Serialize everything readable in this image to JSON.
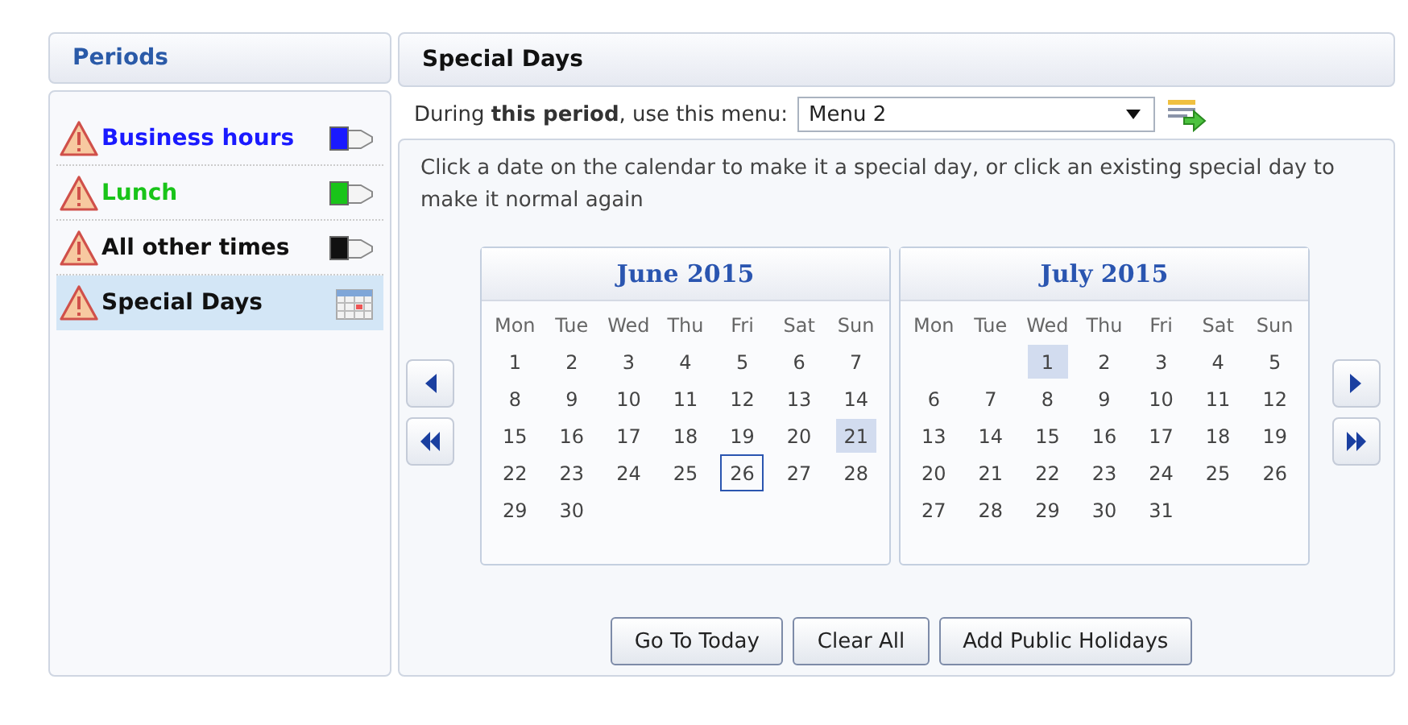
{
  "periods_panel": {
    "title": "Periods",
    "items": [
      {
        "label": "Business hours",
        "color": "#1a1aff",
        "kind": "flag",
        "warning": true,
        "selected": false
      },
      {
        "label": "Lunch",
        "color": "#19c419",
        "kind": "flag",
        "warning": true,
        "selected": false
      },
      {
        "label": "All other times",
        "color": "#111111",
        "kind": "flag",
        "warning": true,
        "selected": false
      },
      {
        "label": "Special Days",
        "color": "#111111",
        "kind": "calendar",
        "warning": true,
        "selected": true
      }
    ]
  },
  "special_days_panel": {
    "title": "Special Days",
    "menu_row": {
      "text": "During **this period**, use this menu:",
      "value": "Menu 2"
    },
    "instructions": "Click a date on the calendar to make it a special day, or click an existing special day to make it normal again",
    "calendars": [
      {
        "title": "June 2015",
        "weekdays": [
          "Mon",
          "Tue",
          "Wed",
          "Thu",
          "Fri",
          "Sat",
          "Sun"
        ],
        "weeks": [
          [
            {
              "day": "1"
            },
            {
              "day": "2"
            },
            {
              "day": "3"
            },
            {
              "day": "4"
            },
            {
              "day": "5"
            },
            {
              "day": "6"
            },
            {
              "day": "7"
            }
          ],
          [
            {
              "day": "8"
            },
            {
              "day": "9"
            },
            {
              "day": "10"
            },
            {
              "day": "11"
            },
            {
              "day": "12"
            },
            {
              "day": "13"
            },
            {
              "day": "14"
            }
          ],
          [
            {
              "day": "15"
            },
            {
              "day": "16"
            },
            {
              "day": "17"
            },
            {
              "day": "18"
            },
            {
              "day": "19"
            },
            {
              "day": "20"
            },
            {
              "day": "21",
              "special": true
            }
          ],
          [
            {
              "day": "22"
            },
            {
              "day": "23"
            },
            {
              "day": "24"
            },
            {
              "day": "25"
            },
            {
              "day": "26",
              "today": true
            },
            {
              "day": "27"
            },
            {
              "day": "28"
            }
          ],
          [
            {
              "day": "29"
            },
            {
              "day": "30"
            }
          ]
        ]
      },
      {
        "title": "July 2015",
        "weekdays": [
          "Mon",
          "Tue",
          "Wed",
          "Thu",
          "Fri",
          "Sat",
          "Sun"
        ],
        "weeks": [
          [
            {
              "day": "1",
              "special": true
            },
            {
              "day": "2"
            },
            {
              "day": "3"
            },
            {
              "day": "4"
            },
            {
              "day": "5"
            }
          ],
          [
            {
              "day": "6"
            },
            {
              "day": "7"
            },
            {
              "day": "8"
            },
            {
              "day": "9"
            },
            {
              "day": "10"
            },
            {
              "day": "11"
            },
            {
              "day": "12"
            }
          ],
          [
            {
              "day": "13"
            },
            {
              "day": "14"
            },
            {
              "day": "15"
            },
            {
              "day": "16"
            },
            {
              "day": "17"
            },
            {
              "day": "18"
            },
            {
              "day": "19"
            }
          ],
          [
            {
              "day": "20"
            },
            {
              "day": "21"
            },
            {
              "day": "22"
            },
            {
              "day": "23"
            },
            {
              "day": "24"
            },
            {
              "day": "25"
            },
            {
              "day": "26"
            }
          ],
          [
            {
              "day": "27"
            },
            {
              "day": "28"
            },
            {
              "day": "29"
            },
            {
              "day": "30"
            },
            {
              "day": "31"
            }
          ]
        ]
      }
    ],
    "buttons": [
      "Go To Today",
      "Clear All",
      "Add Public Holidays"
    ]
  }
}
